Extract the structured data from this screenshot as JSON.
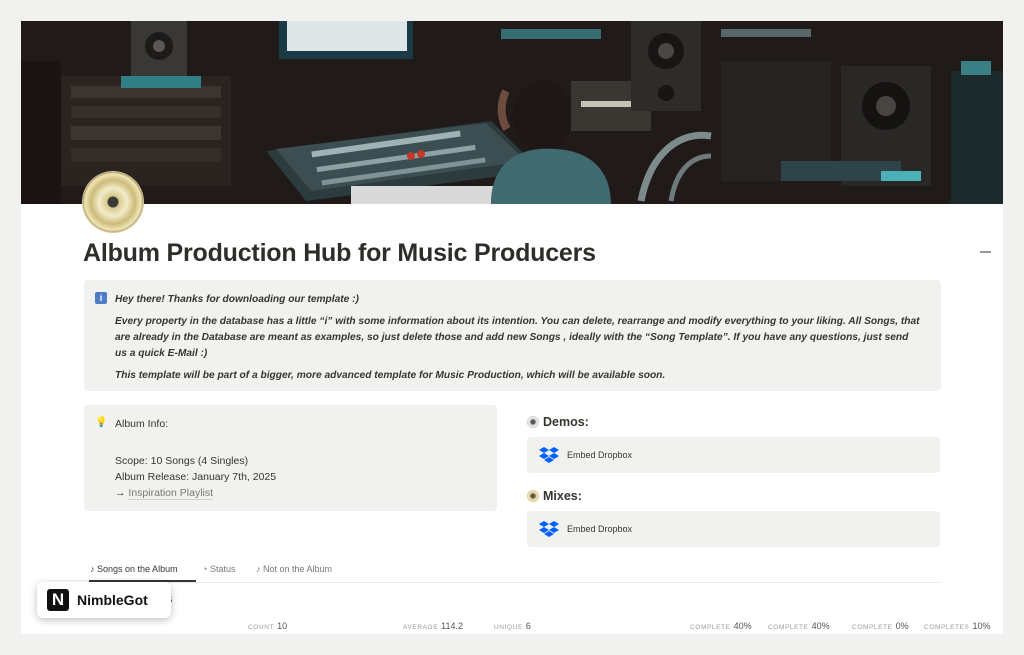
{
  "page": {
    "title": "Album Production Hub for Music Producers"
  },
  "callout": {
    "line1": "Hey there! Thanks for downloading our template :)",
    "line2": "Every property in the database has a little “i” with some information about its intention. You can delete, rearrange and modify everything to your liking. All Songs, that are already in the Database are meant as examples, so just delete those and add new Songs , ideally with the “Song Template”. If you have any questions, just send us a quick E-Mail :)",
    "line3": "This template will be part of a bigger, more advanced template for Music Production, which will be available soon."
  },
  "album_info": {
    "heading": "Album Info:",
    "scope": "Scope: 10 Songs (4 Singles)",
    "release": "Album Release: January 7th, 2025",
    "arrow": "→",
    "link": "Inspiration Playlist"
  },
  "demos": {
    "title": "Demos:",
    "embed_label": "Embed Dropbox"
  },
  "mixes": {
    "title": "Mixes:",
    "embed_label": "Embed Dropbox"
  },
  "tabs": [
    {
      "label": "Songs on the Album",
      "glyph": "♪"
    },
    {
      "label": "Status",
      "glyph": "◔"
    },
    {
      "label": "Not on the Album",
      "glyph": "♪"
    }
  ],
  "database": {
    "title_visible": "ongs"
  },
  "footer": {
    "count_label": "COUNT",
    "count_value": "10",
    "average_label": "AVERAGE",
    "average_value": "114.2",
    "unique_label": "UNIQUE",
    "unique_value": "6",
    "complete": [
      {
        "label": "COMPLETE",
        "value": "40%"
      },
      {
        "label": "COMPLETE",
        "value": "40%"
      },
      {
        "label": "COMPLETE",
        "value": "0%"
      },
      {
        "label": "COMPLETES",
        "value": "10%"
      }
    ]
  },
  "watermark": {
    "letter": "N",
    "text": "NimbleGot"
  }
}
